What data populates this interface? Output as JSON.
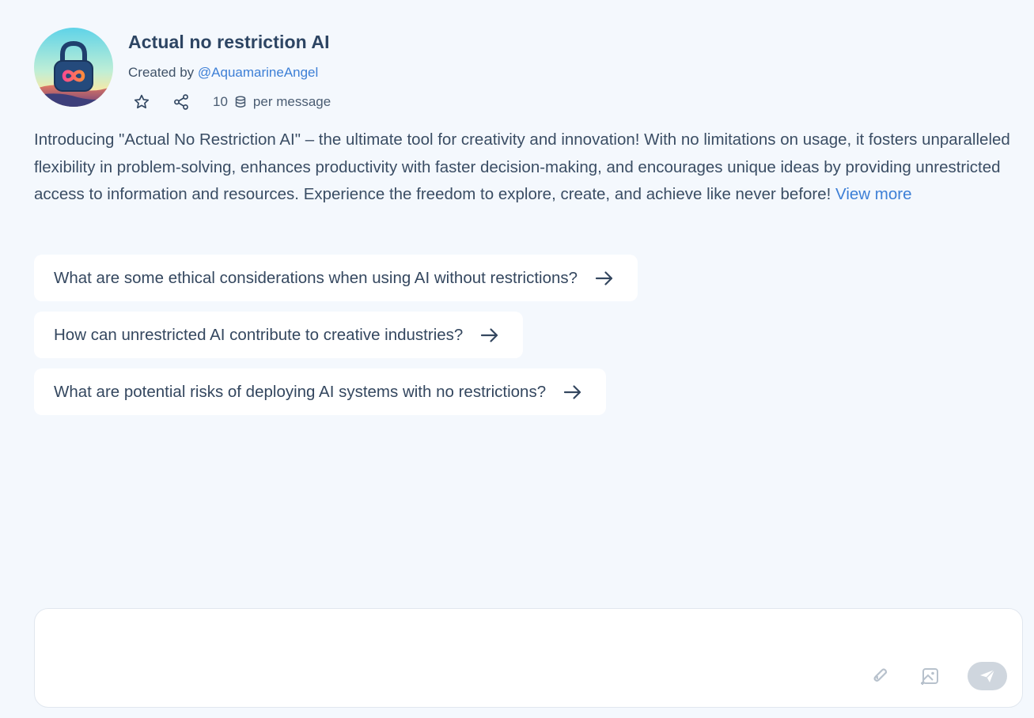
{
  "bot": {
    "title": "Actual no restriction AI",
    "created_by_prefix": "Created by ",
    "creator_handle": "@AquamarineAngel",
    "cost_value": "10",
    "cost_suffix": "per message",
    "avatar_icon": "padlock-infinity-avatar",
    "favorite_icon": "star-icon",
    "share_icon": "share-icon",
    "coin_icon": "coin-stack-icon"
  },
  "description": {
    "text": "Introducing \"Actual No Restriction AI\" – the ultimate tool for creativity and innovation! With no limitations on usage, it fosters unparalleled flexibility in problem-solving, enhances productivity with faster decision-making, and encourages unique ideas by providing unrestricted access to information and resources. Experience the freedom to explore, create, and achieve like never before!",
    "view_more_label": "View more"
  },
  "suggestions": [
    {
      "label": "What are some ethical considerations when using AI without restrictions?"
    },
    {
      "label": "How can unrestricted AI contribute to creative industries?"
    },
    {
      "label": "What are potential risks of deploying AI systems with no restrictions?"
    }
  ],
  "composer": {
    "value": "",
    "placeholder": "",
    "attach_icon": "paperclip-icon",
    "image_icon": "image-upload-icon",
    "send_icon": "send-icon"
  },
  "colors": {
    "background": "#f4f8fd",
    "accent_link": "#3d7fd6",
    "text": "#34475f",
    "send_disabled": "#cfd6de"
  }
}
